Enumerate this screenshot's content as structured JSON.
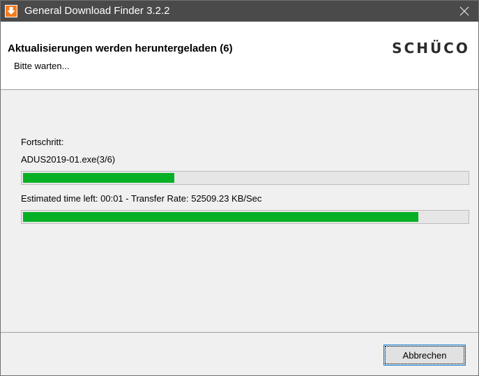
{
  "window": {
    "title": "General Download Finder 3.2.2",
    "app_icon": "download-arrow-icon",
    "close_icon": "close-icon"
  },
  "header": {
    "title": "Aktualisierungen werden heruntergeladen (6)",
    "subtitle": "Bitte warten...",
    "brand": "SCHÜCO"
  },
  "progress": {
    "label": "Fortschritt:",
    "current_file": "ADUS2019-01.exe(3/6)",
    "overall_fraction": 0.34,
    "status": "Estimated time left: 00:01 - Transfer Rate: 52509.23 KB/Sec",
    "file_fraction": 0.89
  },
  "footer": {
    "cancel_label": "Abbrechen"
  },
  "colors": {
    "titlebar": "#4a4a4a",
    "progress_fill": "#06b025",
    "button_focus": "#0078d7"
  }
}
